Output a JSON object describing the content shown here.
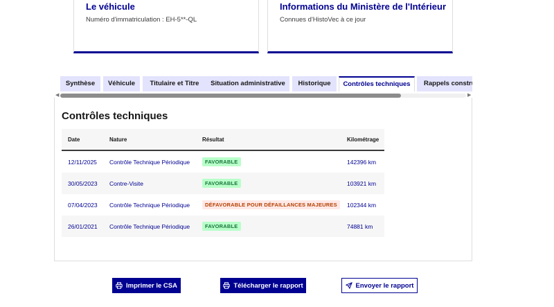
{
  "cards": [
    {
      "title": "Le véhicule",
      "subtitle": "Numéro d'immatriculation : EH-5**-QL"
    },
    {
      "title": "Informations du Ministère de l'Intérieur",
      "subtitle": "Connues d'HistoVec à ce jour"
    }
  ],
  "tabs": [
    {
      "label": "Synthèse"
    },
    {
      "label": "Véhicule"
    },
    {
      "label": "Titulaire et Titre"
    },
    {
      "label": "Situation administrative"
    },
    {
      "label": "Historique"
    },
    {
      "label": "Contrôles techniques"
    },
    {
      "label": "Rappels constructeur"
    }
  ],
  "active_tab": "Contrôles techniques",
  "scroll_arrows": {
    "left": "◀",
    "right": "▶"
  },
  "section_title": "Contrôles techniques",
  "table": {
    "headers": [
      "Date",
      "Nature",
      "Résultat",
      "Kilométrage"
    ],
    "rows": [
      {
        "date": "12/11/2025",
        "nature": "Contrôle Technique Périodique",
        "result": "FAVORABLE",
        "status": "ok",
        "km": "142396 km"
      },
      {
        "date": "30/05/2023",
        "nature": "Contre-Visite",
        "result": "FAVORABLE",
        "status": "ok",
        "km": "103921 km"
      },
      {
        "date": "07/04/2023",
        "nature": "Contrôle Technique Périodique",
        "result": "DÉFAVORABLE POUR DÉFAILLANCES MAJEURES",
        "status": "ko",
        "km": "102344 km"
      },
      {
        "date": "26/01/2021",
        "nature": "Contrôle Technique Périodique",
        "result": "FAVORABLE",
        "status": "ok",
        "km": "74881 km"
      }
    ]
  },
  "buttons": {
    "print": "Imprimer le CSA",
    "download": "Télécharger le rapport",
    "send": "Envoyer le rapport"
  },
  "icons": {
    "print": "printer-icon",
    "download": "printer-icon",
    "send": "send-icon"
  },
  "colors": {
    "primary": "#000091",
    "tab_bg": "#e3e3fd",
    "success_bg": "#b8fec9",
    "success_text": "#18753c",
    "error_bg": "#ffe9e6",
    "error_text": "#b34000"
  }
}
